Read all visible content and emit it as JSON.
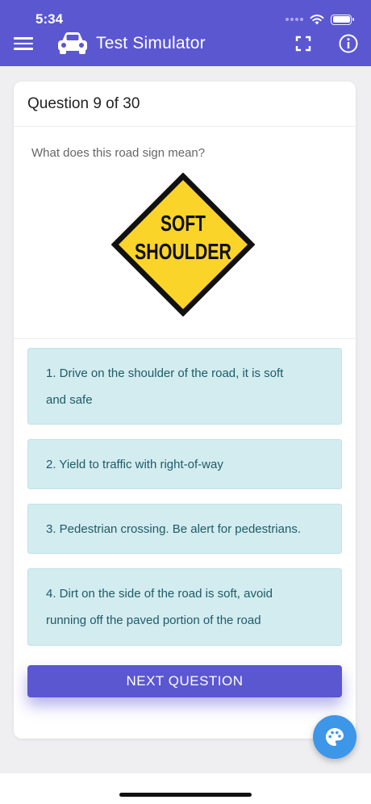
{
  "status_bar": {
    "time": "5:34"
  },
  "app_bar": {
    "title": "Test Simulator"
  },
  "question": {
    "counter": "Question 9 of 30",
    "prompt": "What does this road sign mean?",
    "sign_text": [
      "SOFT",
      "SHOULDER"
    ]
  },
  "options": [
    {
      "line1": "1. Drive on the shoulder of the road, it is soft",
      "line2": "and safe"
    },
    {
      "line1": "2. Yield to traffic with right-of-way",
      "line2": ""
    },
    {
      "line1": "3. Pedestrian crossing. Be alert for pedestrians.",
      "line2": ""
    },
    {
      "line1": "4. Dirt on the side of the road is soft, avoid",
      "line2": "running off the paved portion of the road"
    }
  ],
  "next_label": "NEXT QUESTION",
  "colors": {
    "primary": "#5b57d1",
    "option_bg": "#d2ecf0",
    "option_text": "#1f5b66",
    "sign_yellow": "#fbd42a",
    "fab": "#3d96e8"
  },
  "icons": {
    "menu": "hamburger-icon",
    "car": "car-icon",
    "fullscreen": "fullscreen-icon",
    "info": "info-icon",
    "palette": "palette-icon"
  }
}
